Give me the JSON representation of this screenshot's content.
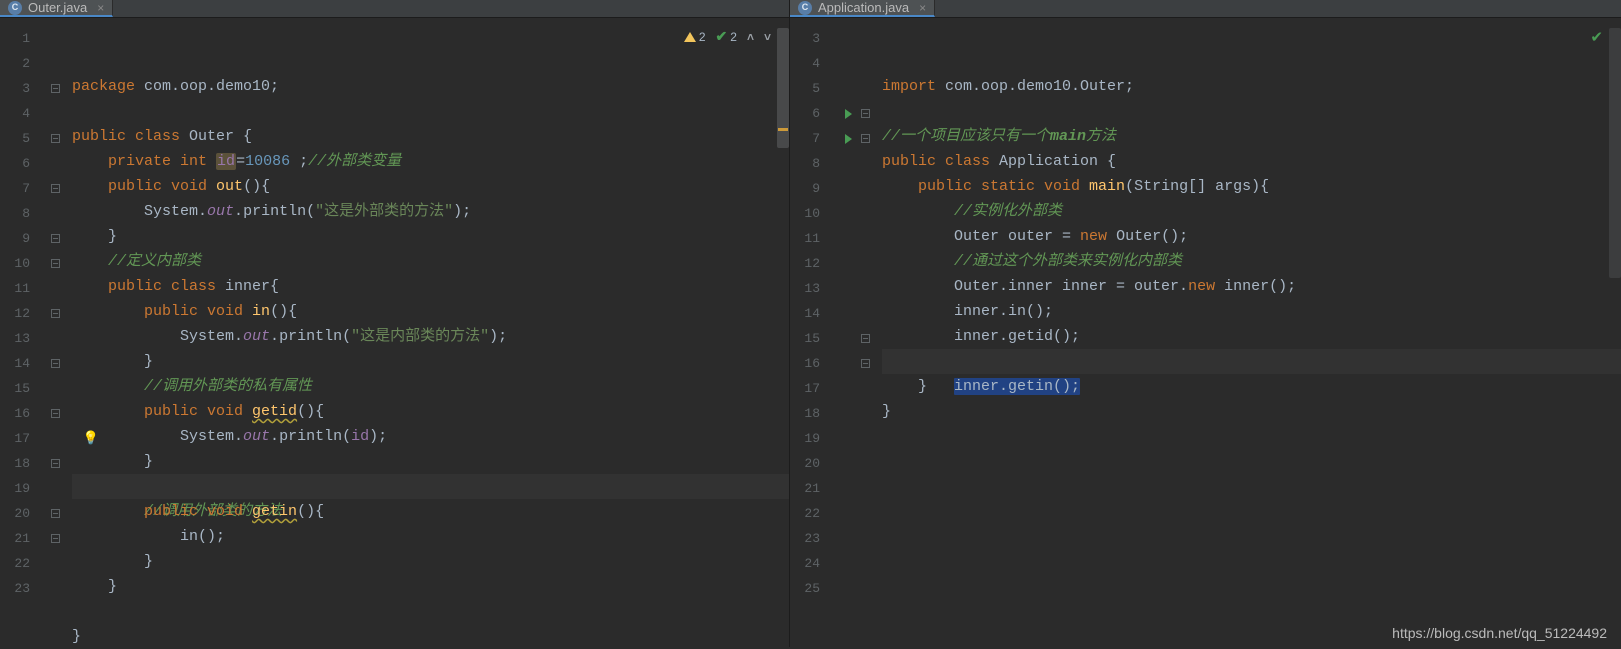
{
  "left": {
    "tab": {
      "filename": "Outer.java",
      "icon_letter": "C"
    },
    "inspection": {
      "warn_count": "2",
      "ok_count": "2"
    },
    "highlight_line_index": 16,
    "bulb_line_index": 16,
    "lines": [
      {
        "n": "1",
        "fold": "",
        "tokens": [
          [
            "kw",
            "package "
          ],
          [
            "plain",
            "com.oop.demo10"
          ],
          [
            "plain",
            ";"
          ]
        ]
      },
      {
        "n": "2",
        "fold": "",
        "tokens": []
      },
      {
        "n": "3",
        "fold": "-",
        "tokens": [
          [
            "kw",
            "public class "
          ],
          [
            "plain",
            "Outer {"
          ]
        ]
      },
      {
        "n": "4",
        "fold": "",
        "tokens": [
          [
            "plain",
            "    "
          ],
          [
            "kw",
            "private int "
          ],
          [
            "id hl-var",
            "id"
          ],
          [
            "plain",
            "="
          ],
          [
            "num",
            "10086"
          ],
          [
            "plain",
            " ;"
          ],
          [
            "cmt",
            "//外部类变量"
          ]
        ]
      },
      {
        "n": "5",
        "fold": "-",
        "tokens": [
          [
            "plain",
            "    "
          ],
          [
            "kw",
            "public void "
          ],
          [
            "fn",
            "out"
          ],
          [
            "plain",
            "(){"
          ]
        ]
      },
      {
        "n": "6",
        "fold": "",
        "tokens": [
          [
            "plain",
            "        System."
          ],
          [
            "id ital",
            "out"
          ],
          [
            "plain",
            "."
          ],
          [
            "plain",
            "println("
          ],
          [
            "str",
            "\"这是外部类的方法\""
          ],
          [
            "plain",
            ");"
          ]
        ]
      },
      {
        "n": "7",
        "fold": "-",
        "tokens": [
          [
            "plain",
            "    }"
          ]
        ]
      },
      {
        "n": "8",
        "fold": "",
        "tokens": [
          [
            "plain",
            "    "
          ],
          [
            "cmt",
            "//定义内部类"
          ]
        ]
      },
      {
        "n": "9",
        "fold": "-",
        "tokens": [
          [
            "plain",
            "    "
          ],
          [
            "kw",
            "public class "
          ],
          [
            "plain",
            "inner{"
          ]
        ]
      },
      {
        "n": "10",
        "fold": "-",
        "tokens": [
          [
            "plain",
            "        "
          ],
          [
            "kw",
            "public void "
          ],
          [
            "fn",
            "in"
          ],
          [
            "plain",
            "(){"
          ]
        ]
      },
      {
        "n": "11",
        "fold": "",
        "tokens": [
          [
            "plain",
            "            System."
          ],
          [
            "id ital",
            "out"
          ],
          [
            "plain",
            "."
          ],
          [
            "plain",
            "println("
          ],
          [
            "str",
            "\"这是内部类的方法\""
          ],
          [
            "plain",
            ");"
          ]
        ]
      },
      {
        "n": "12",
        "fold": "-",
        "tokens": [
          [
            "plain",
            "        }"
          ]
        ]
      },
      {
        "n": "13",
        "fold": "",
        "tokens": [
          [
            "plain",
            "        "
          ],
          [
            "cmt",
            "//调用外部类的私有属性"
          ]
        ]
      },
      {
        "n": "14",
        "fold": "-",
        "tokens": [
          [
            "plain",
            "        "
          ],
          [
            "kw",
            "public void "
          ],
          [
            "fn warn-u",
            "getid"
          ],
          [
            "plain",
            "(){"
          ]
        ]
      },
      {
        "n": "15",
        "fold": "",
        "tokens": [
          [
            "plain",
            "            System."
          ],
          [
            "id ital",
            "out"
          ],
          [
            "plain",
            "."
          ],
          [
            "plain",
            "println("
          ],
          [
            "id",
            "id"
          ],
          [
            "plain",
            ");"
          ]
        ]
      },
      {
        "n": "16",
        "fold": "-",
        "tokens": [
          [
            "plain",
            "        }"
          ]
        ]
      },
      {
        "n": "17",
        "fold": "",
        "tokens": [
          [
            "plain",
            "        "
          ],
          [
            "cmt",
            "//调用外部类的方法"
          ]
        ]
      },
      {
        "n": "18",
        "fold": "-",
        "tokens": [
          [
            "plain",
            "        "
          ],
          [
            "kw",
            "public void "
          ],
          [
            "fn warn-u",
            "getin"
          ],
          [
            "plain",
            "(){"
          ]
        ]
      },
      {
        "n": "19",
        "fold": "",
        "tokens": [
          [
            "plain",
            "            in();"
          ]
        ]
      },
      {
        "n": "20",
        "fold": "-",
        "tokens": [
          [
            "plain",
            "        }"
          ]
        ]
      },
      {
        "n": "21",
        "fold": "-",
        "tokens": [
          [
            "plain",
            "    }"
          ]
        ]
      },
      {
        "n": "22",
        "fold": "",
        "tokens": []
      },
      {
        "n": "23",
        "fold": "",
        "tokens": [
          [
            "plain",
            "}"
          ]
        ]
      }
    ]
  },
  "right": {
    "tab": {
      "filename": "Application.java",
      "icon_letter": "C"
    },
    "highlight_line_index": 11,
    "lines": [
      {
        "n": "3",
        "fold": "",
        "run": false,
        "tokens": [
          [
            "kw",
            "import "
          ],
          [
            "plain",
            "com.oop.demo10.Outer"
          ],
          [
            "plain",
            ";"
          ]
        ]
      },
      {
        "n": "4",
        "fold": "",
        "run": false,
        "tokens": []
      },
      {
        "n": "5",
        "fold": "",
        "run": false,
        "tokens": [
          [
            "cmt",
            "//一个项目应该只有一个"
          ],
          [
            "cmt-bold",
            "main"
          ],
          [
            "cmt",
            "方法"
          ]
        ]
      },
      {
        "n": "6",
        "fold": "-",
        "run": true,
        "tokens": [
          [
            "kw",
            "public class "
          ],
          [
            "plain",
            "Application {"
          ]
        ]
      },
      {
        "n": "7",
        "fold": "-",
        "run": true,
        "tokens": [
          [
            "plain",
            "    "
          ],
          [
            "kw",
            "public static void "
          ],
          [
            "fn",
            "main"
          ],
          [
            "plain",
            "(String[] args){"
          ]
        ]
      },
      {
        "n": "8",
        "fold": "",
        "run": false,
        "tokens": [
          [
            "plain",
            "        "
          ],
          [
            "cmt",
            "//实例化外部类"
          ]
        ]
      },
      {
        "n": "9",
        "fold": "",
        "run": false,
        "tokens": [
          [
            "plain",
            "        Outer outer = "
          ],
          [
            "kw",
            "new "
          ],
          [
            "plain",
            "Outer();"
          ]
        ]
      },
      {
        "n": "10",
        "fold": "",
        "run": false,
        "tokens": [
          [
            "plain",
            "        "
          ],
          [
            "cmt",
            "//通过这个外部类来实例化内部类"
          ]
        ]
      },
      {
        "n": "11",
        "fold": "",
        "run": false,
        "tokens": [
          [
            "plain",
            "        Outer.inner inner = outer."
          ],
          [
            "kw",
            "new "
          ],
          [
            "plain",
            "inner();"
          ]
        ]
      },
      {
        "n": "12",
        "fold": "",
        "run": false,
        "tokens": [
          [
            "plain",
            "        inner.in();"
          ]
        ]
      },
      {
        "n": "13",
        "fold": "",
        "run": false,
        "tokens": [
          [
            "plain",
            "        inner.getid();"
          ]
        ]
      },
      {
        "n": "14",
        "fold": "",
        "run": false,
        "tokens": [
          [
            "plain",
            "        "
          ],
          [
            "plain selbg",
            "inner.getin();"
          ]
        ]
      },
      {
        "n": "15",
        "fold": "-",
        "run": false,
        "tokens": [
          [
            "plain",
            "    }"
          ]
        ]
      },
      {
        "n": "16",
        "fold": "-",
        "run": false,
        "tokens": [
          [
            "plain",
            "}"
          ]
        ]
      },
      {
        "n": "17",
        "fold": "",
        "run": false,
        "tokens": []
      },
      {
        "n": "18",
        "fold": "",
        "run": false,
        "tokens": []
      },
      {
        "n": "19",
        "fold": "",
        "run": false,
        "tokens": []
      },
      {
        "n": "20",
        "fold": "",
        "run": false,
        "tokens": []
      },
      {
        "n": "21",
        "fold": "",
        "run": false,
        "tokens": []
      },
      {
        "n": "22",
        "fold": "",
        "run": false,
        "tokens": []
      },
      {
        "n": "23",
        "fold": "",
        "run": false,
        "tokens": []
      },
      {
        "n": "24",
        "fold": "",
        "run": false,
        "tokens": []
      },
      {
        "n": "25",
        "fold": "",
        "run": false,
        "tokens": []
      }
    ]
  },
  "watermark": "https://blog.csdn.net/qq_51224492"
}
